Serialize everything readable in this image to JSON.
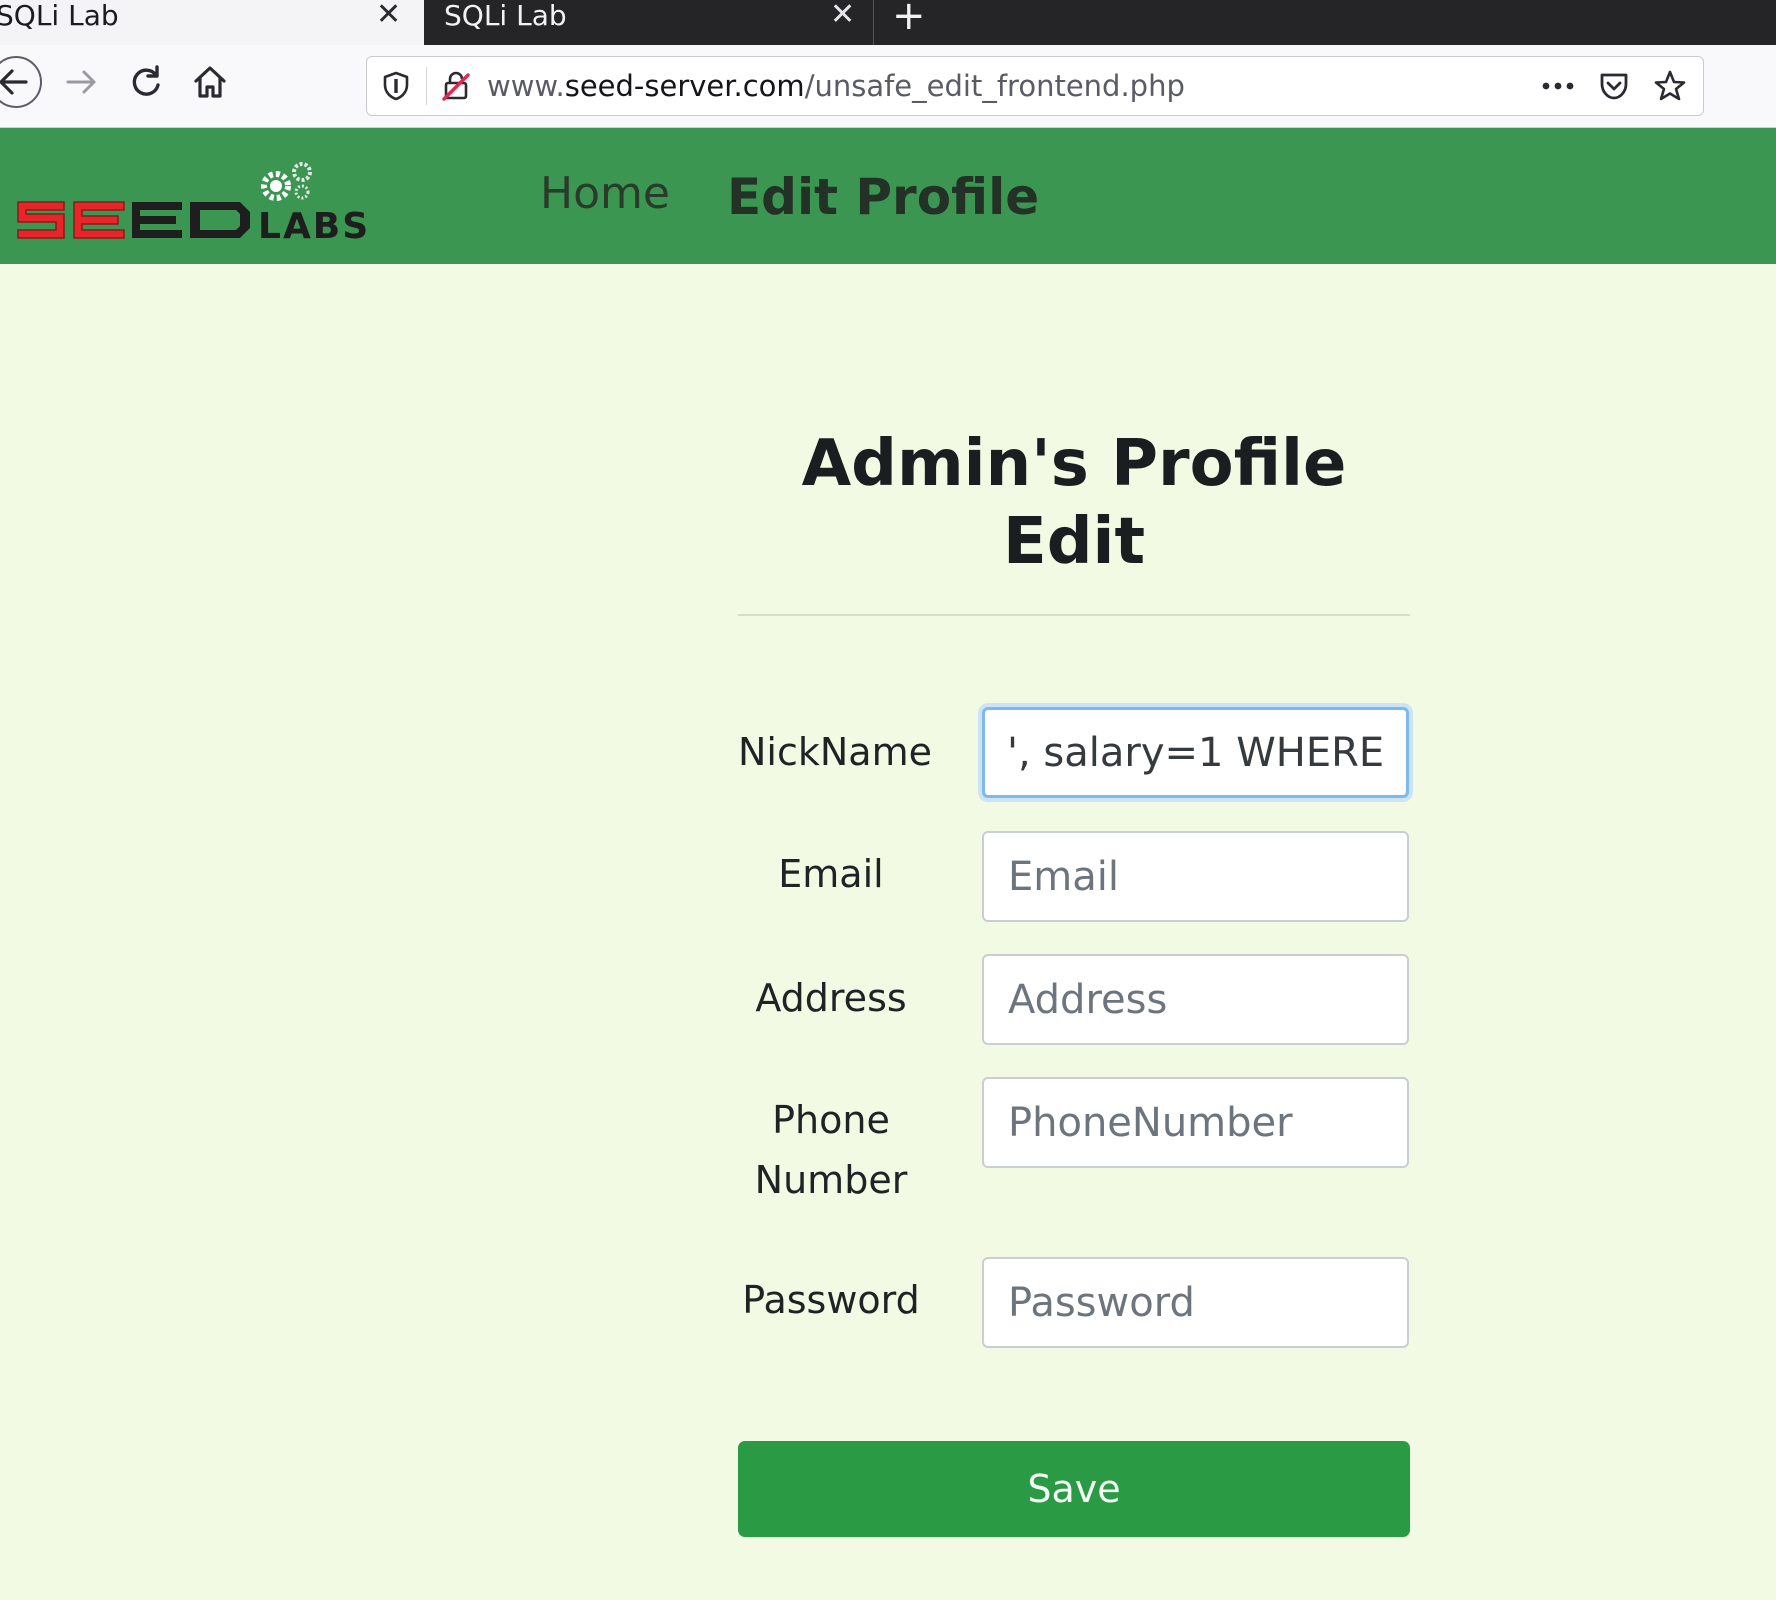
{
  "browser": {
    "tabs": [
      {
        "label": "SQLi Lab",
        "active": true
      },
      {
        "label": "SQLi Lab",
        "active": false
      }
    ],
    "new_tab_icon": "plus-icon",
    "address": {
      "host_prefix": "www.",
      "host": "seed-server.com",
      "path": "/unsafe_edit_frontend.php"
    },
    "toolbar_icons": [
      "back-icon",
      "forward-icon",
      "reload-icon",
      "home-icon",
      "shield-icon",
      "insecure-lock-icon",
      "more-icon",
      "pocket-icon",
      "star-icon"
    ]
  },
  "header": {
    "logo_text": "SEED LABS",
    "nav": {
      "home": "Home",
      "edit_profile": "Edit Profile"
    },
    "bg_color": "#3b9651"
  },
  "form": {
    "title_line1": "Admin's Profile",
    "title_line2": "Edit",
    "fields": [
      {
        "label": "NickName",
        "value": "', salary=1 WHERE",
        "placeholder": "NickName",
        "focused": true
      },
      {
        "label": "Email",
        "value": "",
        "placeholder": "Email"
      },
      {
        "label": "Address",
        "value": "",
        "placeholder": "Address"
      },
      {
        "label_line1": "Phone",
        "label_line2": "Number",
        "value": "",
        "placeholder": "PhoneNumber"
      },
      {
        "label": "Password",
        "value": "",
        "placeholder": "Password"
      }
    ],
    "save_label": "Save",
    "save_color": "#2a9a45"
  }
}
